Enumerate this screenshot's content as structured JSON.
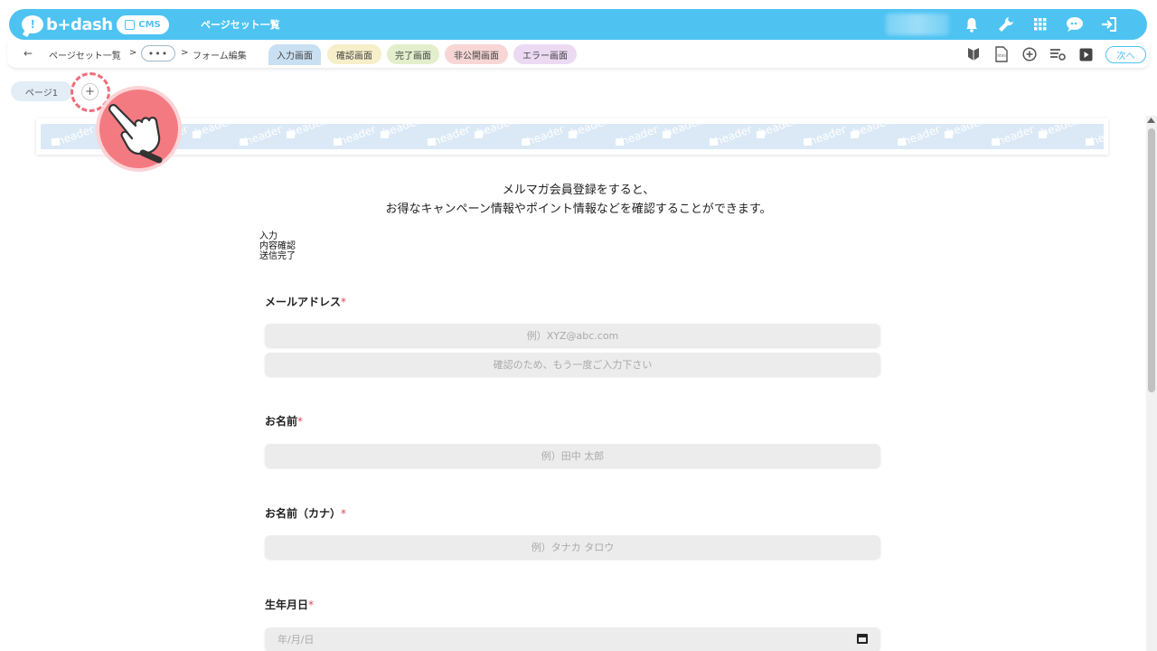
{
  "topbar": {
    "logo_text": "b+dash",
    "cms_label": "CMS",
    "title": "ページセット一覧",
    "icons": [
      "bell-icon",
      "wrench-icon",
      "grid-icon",
      "chat-icon",
      "logout-icon"
    ]
  },
  "subnav": {
    "back_icon": "←",
    "crumb_1": "ページセット一覧",
    "sep": ">",
    "dots": "•••",
    "crumb_2": "フォーム編集",
    "tabs": [
      {
        "label": "入力画面",
        "color": "#c9e0f2"
      },
      {
        "label": "確認画面",
        "color": "#f6efc9"
      },
      {
        "label": "完了画面",
        "color": "#e3efcc"
      },
      {
        "label": "非公開画面",
        "color": "#f8d6d6"
      },
      {
        "label": "エラー画面",
        "color": "#ecdaf3"
      }
    ],
    "right_icons": [
      "beginner-icon",
      "html-file-icon",
      "add-circle-icon",
      "list-settings-icon",
      "play-icon"
    ],
    "next_label": "次へ"
  },
  "pages": {
    "page1_label": "ページ1",
    "add_label": "+"
  },
  "banner": {
    "text": "header"
  },
  "form": {
    "intro_line1": "メルマガ会員登録をすると、",
    "intro_line2": "お得なキャンペーン情報やポイント情報などを確認することができます。",
    "steps": [
      "入力",
      "内容確認",
      "送信完了"
    ],
    "required_mark": "*",
    "fields": {
      "email_label": "メールアドレス",
      "email_placeholder": "例）XYZ@abc.com",
      "email_confirm_placeholder": "確認のため、もう一度ご入力下さい",
      "name_label": "お名前",
      "name_placeholder": "例）田中 太郎",
      "kana_label": "お名前（カナ）",
      "kana_placeholder": "例）タナカ タロウ",
      "birth_label": "生年月日",
      "birth_placeholder": "年/月/日"
    }
  },
  "colors": {
    "brand": "#4ec3f2",
    "accent_red": "#f47a82",
    "required": "#e0465a"
  }
}
